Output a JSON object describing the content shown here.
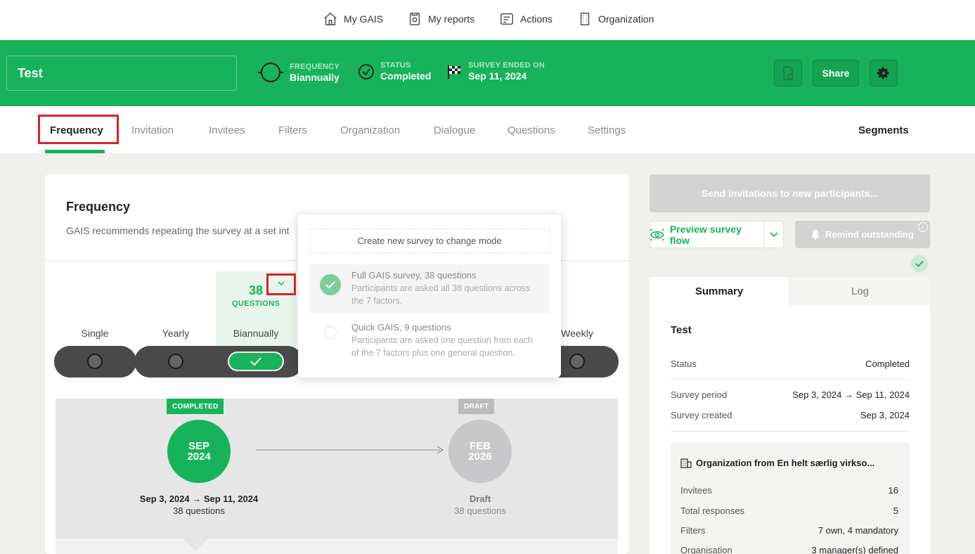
{
  "topnav": {
    "items": [
      {
        "label": "My GAIS",
        "icon": "home-icon"
      },
      {
        "label": "My reports",
        "icon": "report-icon"
      },
      {
        "label": "Actions",
        "icon": "actions-icon"
      },
      {
        "label": "Organization",
        "icon": "building-icon"
      }
    ]
  },
  "header": {
    "survey_title": "Test",
    "frequency_label": "FREQUENCY",
    "frequency_value": "Biannually",
    "status_label": "STATUS",
    "status_value": "Completed",
    "ended_label": "SURVEY ENDED ON",
    "ended_value": "Sep 11, 2024",
    "share_label": "Share"
  },
  "tabs": {
    "items": [
      "Frequency",
      "Invitation",
      "Invitees",
      "Filters",
      "Organization",
      "Dialogue",
      "Questions",
      "Settings"
    ],
    "segments": "Segments",
    "active": "Frequency"
  },
  "frequency_card": {
    "title": "Frequency",
    "description": "GAIS recommends repeating the survey at a set int",
    "question_count": "38",
    "question_label": "QUESTIONS",
    "options": [
      "Single",
      "Yearly",
      "Biannually",
      "Weekly"
    ],
    "selected": "Biannually"
  },
  "timeline": {
    "first": {
      "badge": "COMPLETED",
      "month": "SEP",
      "year": "2024",
      "period": "Sep 3, 2024 → Sep 11, 2024",
      "questions": "38 questions"
    },
    "second": {
      "badge": "DRAFT",
      "month": "FEB",
      "year": "2026",
      "status": "Draft",
      "questions": "38 questions"
    }
  },
  "popup": {
    "hint": "Create new survey to change mode",
    "options": [
      {
        "title": "Full GAIS survey, 38 questions",
        "desc": "Participants are asked all 38 questions across the 7 factors.",
        "selected": true
      },
      {
        "title": "Quick GAIS, 9 questions",
        "desc": "Participants are asked one question from each of the 7 factors plus one general question.",
        "selected": false
      }
    ]
  },
  "right": {
    "send_label": "Send invitations to new participants...",
    "preview_label": "Preview survey flow",
    "remind_label": "Remind outstanding",
    "tabs": [
      "Summary",
      "Log"
    ],
    "summary": {
      "title": "Test",
      "status_label": "Status",
      "status_value": "Completed",
      "period_label": "Survey period",
      "period_value": "Sep 3, 2024 → Sep 11, 2024",
      "created_label": "Survey created",
      "created_value": "Sep 3, 2024"
    },
    "org": {
      "title": "Organization from En helt særlig virkso...",
      "rows": [
        {
          "label": "Invitees",
          "value": "16"
        },
        {
          "label": "Total responses",
          "value": "5"
        },
        {
          "label": "Filters",
          "value": "7 own, 4 mandatory"
        },
        {
          "label": "Organisation",
          "value": "3 manager(s) defined"
        }
      ]
    }
  },
  "colors": {
    "brand_green": "#17b35a",
    "highlight_red": "#d9232a"
  }
}
